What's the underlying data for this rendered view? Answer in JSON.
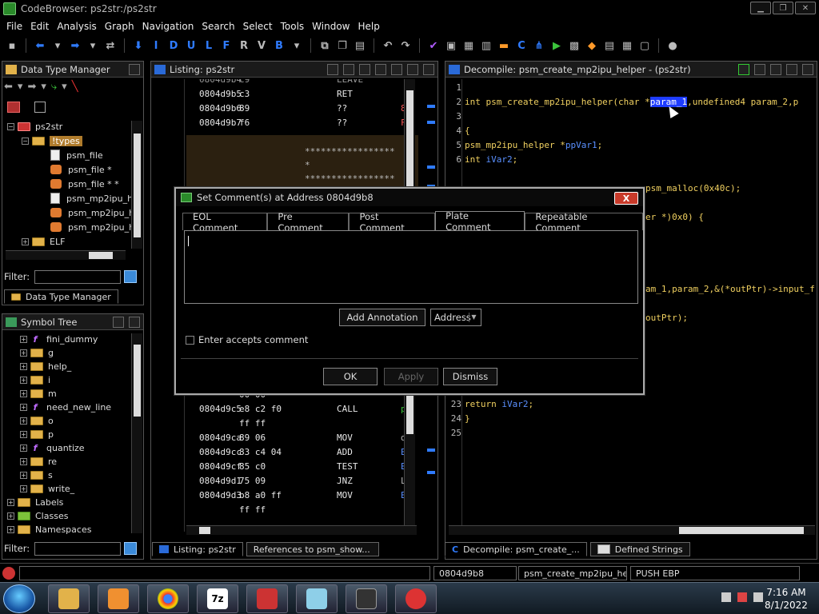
{
  "window": {
    "title": "CodeBrowser: ps2str:/ps2str"
  },
  "menu": [
    "File",
    "Edit",
    "Analysis",
    "Graph",
    "Navigation",
    "Search",
    "Select",
    "Tools",
    "Window",
    "Help"
  ],
  "toolbar": {
    "letters": [
      "I",
      "D",
      "U",
      "L",
      "F",
      "R",
      "V",
      "B"
    ]
  },
  "data_type_manager": {
    "title": "Data Type Manager",
    "tree": [
      {
        "label": "ps2str",
        "type": "root"
      },
      {
        "label": "!types",
        "type": "folder-selected"
      },
      {
        "label": "psm_file",
        "type": "file"
      },
      {
        "label": "psm_file *",
        "type": "hand"
      },
      {
        "label": "psm_file * *",
        "type": "hand"
      },
      {
        "label": "psm_mp2ipu_h",
        "type": "file"
      },
      {
        "label": "psm_mp2ipu_h",
        "type": "hand"
      },
      {
        "label": "psm_mp2ipu_h",
        "type": "hand"
      },
      {
        "label": "ELF",
        "type": "folder"
      }
    ],
    "filter_label": "Filter:",
    "tab_label": "Data Type Manager"
  },
  "symbol_tree": {
    "title": "Symbol Tree",
    "items": [
      {
        "label": "fini_dummy",
        "type": "func"
      },
      {
        "label": "g",
        "type": "folder"
      },
      {
        "label": "help_",
        "type": "folder"
      },
      {
        "label": "i",
        "type": "folder"
      },
      {
        "label": "m",
        "type": "folder"
      },
      {
        "label": "need_new_line",
        "type": "func"
      },
      {
        "label": "o",
        "type": "folder"
      },
      {
        "label": "p",
        "type": "folder"
      },
      {
        "label": "quantize",
        "type": "func"
      },
      {
        "label": "re",
        "type": "folder"
      },
      {
        "label": "s",
        "type": "folder"
      },
      {
        "label": "write_",
        "type": "folder"
      },
      {
        "label": "Labels",
        "type": "folder-top"
      },
      {
        "label": "Classes",
        "type": "folder-top"
      },
      {
        "label": "Namespaces",
        "type": "folder-top"
      }
    ],
    "filter_label": "Filter:"
  },
  "listing": {
    "title": "Listing:  ps2str",
    "top_rows": [
      {
        "addr": "0804d9b5",
        "bytes": "c3",
        "mnem": "RET",
        "oper": ""
      },
      {
        "addr": "0804d9b6",
        "bytes": "89",
        "mnem": "??",
        "oper": "8"
      },
      {
        "addr": "0804d9b7",
        "bytes": "f6",
        "mnem": "??",
        "oper": "F"
      }
    ],
    "plate_stars": "*****************",
    "plate_star": "*",
    "bottom_rows": [
      {
        "addr": "",
        "bytes": "00 00",
        "mnem": "",
        "oper": ""
      },
      {
        "addr": "0804d9c5",
        "bytes": "e8 c2 f0",
        "mnem": "CALL",
        "oper": "p"
      },
      {
        "addr": "",
        "bytes": "ff ff",
        "mnem": "",
        "oper": ""
      },
      {
        "addr": "0804d9ca",
        "bytes": "89 06",
        "mnem": "MOV",
        "oper": "d"
      },
      {
        "addr": "0804d9cc",
        "bytes": "83 c4 04",
        "mnem": "ADD",
        "oper": "E"
      },
      {
        "addr": "0804d9cf",
        "bytes": "85 c0",
        "mnem": "TEST",
        "oper": "E"
      },
      {
        "addr": "0804d9d1",
        "bytes": "75 09",
        "mnem": "JNZ",
        "oper": "L"
      },
      {
        "addr": "0804d9d3",
        "bytes": "b8 a0 ff",
        "mnem": "MOV",
        "oper": "E"
      },
      {
        "addr": "",
        "bytes": "ff ff",
        "mnem": "",
        "oper": ""
      }
    ]
  },
  "decompile": {
    "title": "Decompile: psm_create_mp2ipu_helper -  (ps2str)",
    "lines": [
      {
        "n": "1",
        "pre": "",
        "hl": "",
        "post": ""
      },
      {
        "n": "2",
        "pre": "int psm_create_mp2ipu_helper(char *",
        "hl": "param_1",
        "post": ",undefined4 param_2,p"
      },
      {
        "n": "3",
        "pre": "",
        "hl": "",
        "post": ""
      },
      {
        "n": "4",
        "pre": "{",
        "hl": "",
        "post": ""
      },
      {
        "n": "5",
        "pre": "  psm_mp2ipu_helper *",
        "var": "ppVar1",
        "post": ";"
      },
      {
        "n": "6",
        "pre": "  int ",
        "var": "iVar2",
        "post": ";"
      }
    ],
    "hidden_fragments": [
      {
        "text": "psm_malloc(0x40c);"
      },
      {
        "text": "er *)0x0) {"
      },
      {
        "text": "am_1,param_2,&(*outPtr)->input_f"
      },
      {
        "text": "outPtr);"
      }
    ],
    "tail_lines": [
      {
        "n": "23",
        "pre": "  return ",
        "var": "iVar2",
        "post": ";"
      },
      {
        "n": "24",
        "pre": "}",
        "var": "",
        "post": ""
      },
      {
        "n": "25",
        "pre": "",
        "var": "",
        "post": ""
      }
    ]
  },
  "bottom_tabs": {
    "listing_tab": "Listing:  ps2str",
    "references_tab": "References to psm_show...",
    "decompile_tab": "Decompile: psm_create_...",
    "strings_tab": "Defined Strings"
  },
  "statusbar": {
    "address": "0804d9b8",
    "function": "psm_create_mp2ipu_he...",
    "instruction": "PUSH EBP"
  },
  "dialog": {
    "title": "Set Comment(s) at Address 0804d9b8",
    "close": "X",
    "tabs": [
      "EOL Comment",
      "Pre Comment",
      "Post Comment",
      "Plate Comment",
      "Repeatable Comment"
    ],
    "active_tab": "Plate Comment",
    "comment_value": "",
    "add_annotation": "Add Annotation",
    "annotation_type": "Address",
    "enter_accepts": "Enter accepts comment",
    "ok": "OK",
    "apply": "Apply",
    "dismiss": "Dismiss"
  },
  "taskbar": {
    "time": "7:16 AM",
    "date": "8/1/2022"
  },
  "colors": {
    "keyword": "#f0d060",
    "variable": "#5a90ff",
    "highlight": "#1e3cff",
    "selected_folder": "#b07c2c"
  }
}
